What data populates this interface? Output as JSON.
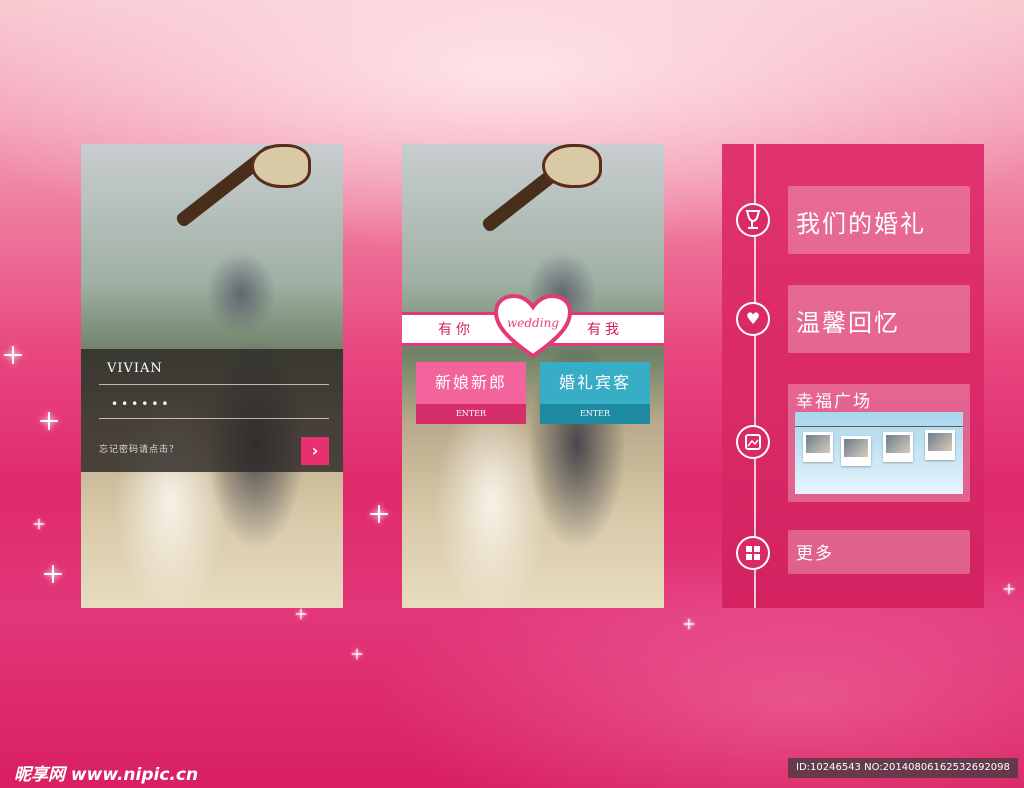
{
  "screen1": {
    "username": "VIVIAN",
    "password_mask": "••••••",
    "forgot_text": "忘记密码请点击？",
    "go_button_glyph": "›"
  },
  "screen2": {
    "ribbon_left": "有你",
    "ribbon_right": "有我",
    "badge_text": "wedding",
    "bride_groom_label": "新娘新郎",
    "guest_label": "婚礼宾客",
    "enter_label": "ENTER"
  },
  "screen3": {
    "menu": [
      {
        "label": "我们的婚礼",
        "icon": "wine-glass-icon"
      },
      {
        "label": "温馨回忆",
        "icon": "heart-icon"
      },
      {
        "label": "幸福广场",
        "icon": "photo-icon"
      },
      {
        "label": "更多",
        "icon": "grid-icon"
      }
    ]
  },
  "footer": {
    "watermark_brand": "昵享网",
    "watermark_site": "www.nipic.cn",
    "image_id": "ID:10246543 NO:20140806162532692098"
  },
  "colors": {
    "accent_pink": "#e7306f",
    "teal": "#37aec6"
  }
}
